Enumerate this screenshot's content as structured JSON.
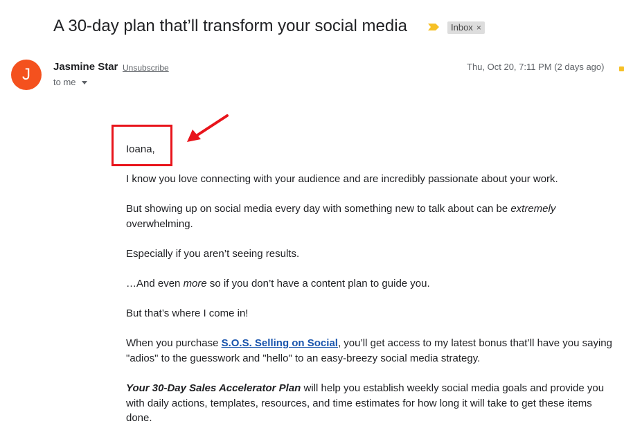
{
  "email": {
    "subject": "A 30-day plan that’ll transform your social media",
    "label": "Inbox",
    "label_close": "×",
    "sender": {
      "initial": "J",
      "name": "Jasmine Star",
      "unsubscribe": "Unsubscribe",
      "recipient": "to me"
    },
    "date": "Thu, Oct 20, 7:11 PM (2 days ago)",
    "colors": {
      "avatar": "#f4511e",
      "highlight": "#e8141b",
      "link": "#1a55ad",
      "importance": "#f6c026"
    },
    "body": {
      "greeting": "Ioana,",
      "p1": "I know you love connecting with your audience and are incredibly passionate about your work.",
      "p2_a": "But showing up on social media every day with something new to talk about can be ",
      "p2_em": "extremely",
      "p2_b": "overwhelming.",
      "p3": "Especially if you aren’t seeing results.",
      "p4_a": "…And even ",
      "p4_em": "more",
      "p4_b": " so if you don’t have a content plan to guide you.",
      "p5": "But that’s where I come in!",
      "p6_a": "When you purchase ",
      "p6_link": "S.O.S. Selling on Social",
      "p6_b": ", you’ll get access to my latest bonus that’ll have you saying",
      "p6_c": "\"adios\" to the guesswork and \"hello\" to an easy-breezy social media strategy.",
      "p7_em": "Your 30-Day Sales Accelerator Plan",
      "p7_a": " will help you establish weekly social media goals and provide you",
      "p7_b": "with daily actions, templates, resources, and time estimates for how long it will take to get these items",
      "p7_c": "done."
    }
  }
}
